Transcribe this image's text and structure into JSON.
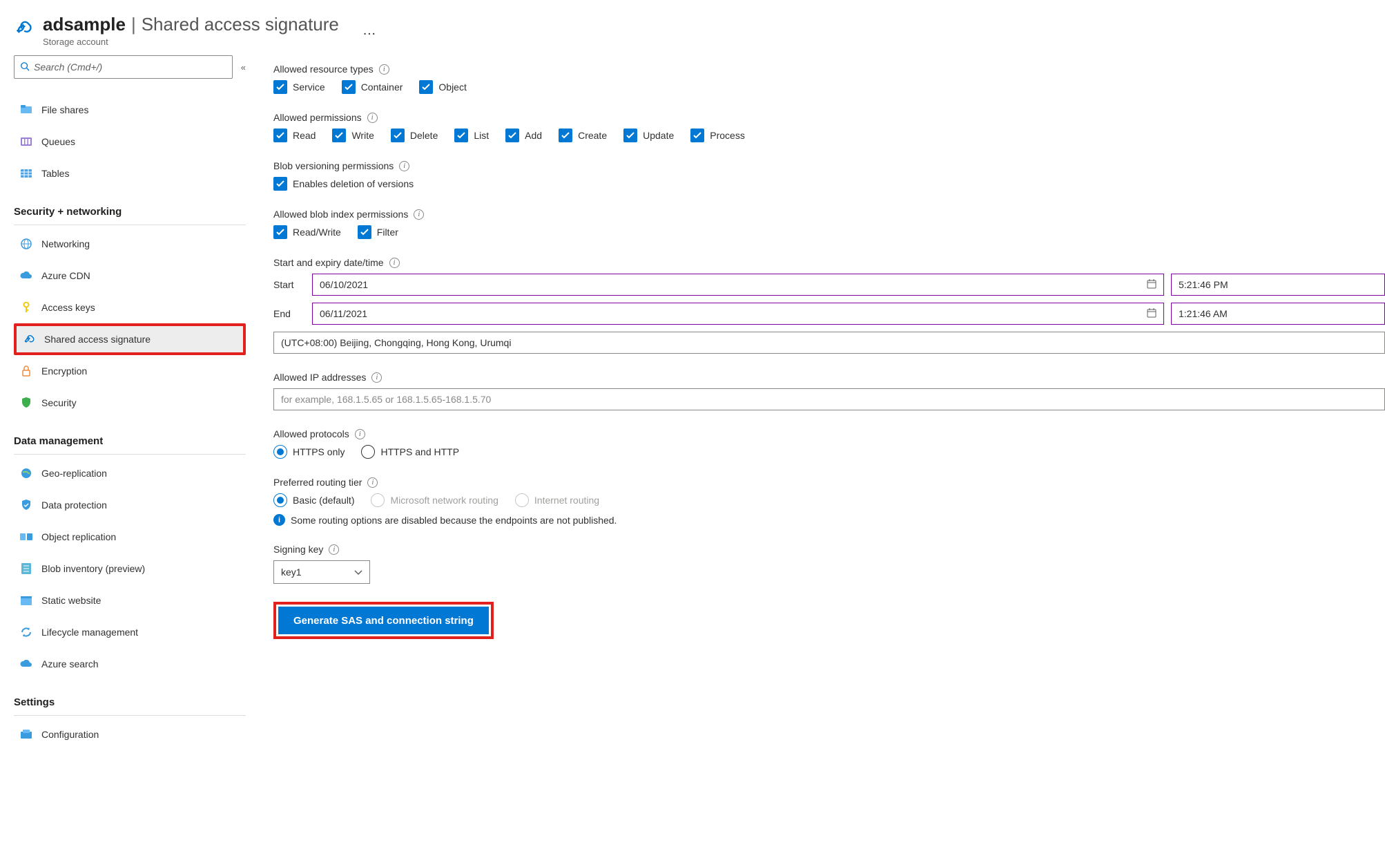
{
  "header": {
    "resource_name": "adsample",
    "separator": "|",
    "page_title": "Shared access signature",
    "subtitle": "Storage account",
    "more": "…"
  },
  "sidebar": {
    "search_placeholder": "Search (Cmd+/)",
    "top_items": [
      {
        "label": "File shares"
      },
      {
        "label": "Queues"
      },
      {
        "label": "Tables"
      }
    ],
    "groups": [
      {
        "title": "Security + networking",
        "items": [
          {
            "label": "Networking"
          },
          {
            "label": "Azure CDN"
          },
          {
            "label": "Access keys"
          },
          {
            "label": "Shared access signature",
            "selected": true,
            "highlighted": true
          },
          {
            "label": "Encryption"
          },
          {
            "label": "Security"
          }
        ]
      },
      {
        "title": "Data management",
        "items": [
          {
            "label": "Geo-replication"
          },
          {
            "label": "Data protection"
          },
          {
            "label": "Object replication"
          },
          {
            "label": "Blob inventory (preview)"
          },
          {
            "label": "Static website"
          },
          {
            "label": "Lifecycle management"
          },
          {
            "label": "Azure search"
          }
        ]
      },
      {
        "title": "Settings",
        "items": [
          {
            "label": "Configuration"
          }
        ]
      }
    ]
  },
  "form": {
    "resource_types": {
      "label": "Allowed resource types",
      "options": [
        "Service",
        "Container",
        "Object"
      ]
    },
    "permissions": {
      "label": "Allowed permissions",
      "options": [
        "Read",
        "Write",
        "Delete",
        "List",
        "Add",
        "Create",
        "Update",
        "Process"
      ]
    },
    "blob_versioning": {
      "label": "Blob versioning permissions",
      "option": "Enables deletion of versions"
    },
    "blob_index": {
      "label": "Allowed blob index permissions",
      "options": [
        "Read/Write",
        "Filter"
      ]
    },
    "datetime": {
      "label": "Start and expiry date/time",
      "start_label": "Start",
      "end_label": "End",
      "start_date": "06/10/2021",
      "start_time": "5:21:46 PM",
      "end_date": "06/11/2021",
      "end_time": "1:21:46 AM",
      "timezone": "(UTC+08:00) Beijing, Chongqing, Hong Kong, Urumqi"
    },
    "ip": {
      "label": "Allowed IP addresses",
      "placeholder": "for example, 168.1.5.65 or 168.1.5.65-168.1.5.70"
    },
    "protocols": {
      "label": "Allowed protocols",
      "options": [
        "HTTPS only",
        "HTTPS and HTTP"
      ],
      "selected": "HTTPS only"
    },
    "routing": {
      "label": "Preferred routing tier",
      "options": [
        {
          "label": "Basic (default)",
          "selected": true,
          "disabled": false
        },
        {
          "label": "Microsoft network routing",
          "disabled": true
        },
        {
          "label": "Internet routing",
          "disabled": true
        }
      ],
      "note": "Some routing options are disabled because the endpoints are not published."
    },
    "signing_key": {
      "label": "Signing key",
      "value": "key1"
    },
    "submit_label": "Generate SAS and connection string"
  }
}
